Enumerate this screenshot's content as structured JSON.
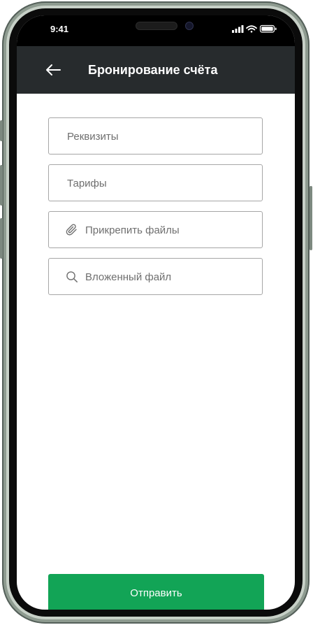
{
  "status_bar": {
    "time": "9:41"
  },
  "app_bar": {
    "title": "Бронирование счёта",
    "back_icon": "arrow-left-icon"
  },
  "form": {
    "fields": [
      {
        "placeholder": "Реквизиты",
        "icon": null
      },
      {
        "placeholder": "Тарифы",
        "icon": null
      },
      {
        "placeholder": "Прикрепить файлы",
        "icon": "paperclip-icon"
      },
      {
        "placeholder": "Вложенный файл",
        "icon": "search-icon"
      }
    ],
    "submit_label": "Отправить"
  },
  "colors": {
    "app_bar": "#272b2d",
    "primary_button": "#12a456",
    "field_border": "#a6a6a6",
    "placeholder": "#6f6f6f",
    "device_frame": "#8e9b90"
  }
}
